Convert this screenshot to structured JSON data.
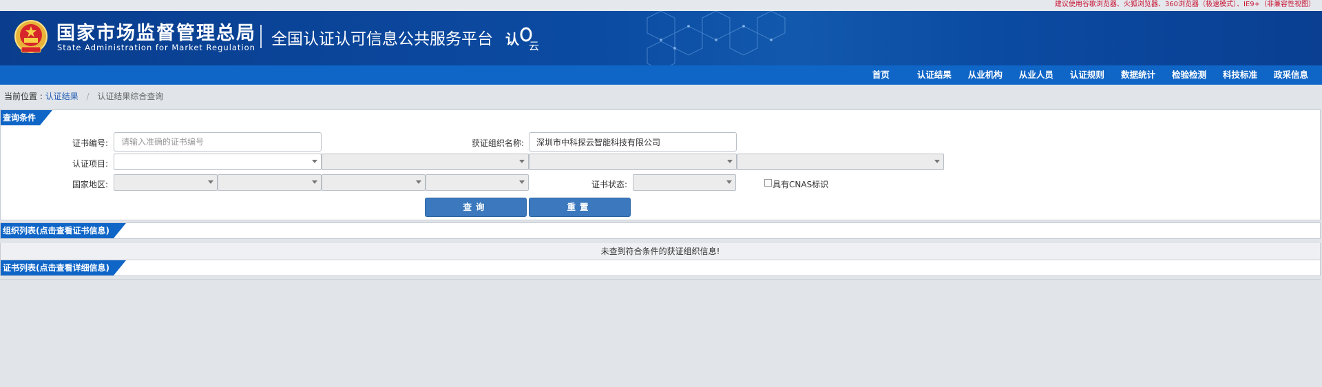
{
  "browser_note": "建议使用谷歌浏览器、火狐浏览器、360浏览器（极速模式）、IE9+（非兼容性视图）",
  "header": {
    "org_name_cn": "国家市场监督管理总局",
    "org_name_en": "State Administration  for  Market Regulation",
    "platform_title": "全国认证认可信息公共服务平台",
    "logo_text_1": "认",
    "logo_text_2": "云"
  },
  "nav": {
    "items": [
      "首页",
      "认证结果",
      "从业机构",
      "从业人员",
      "认证规则",
      "数据统计",
      "检验检测",
      "科技标准",
      "政采信息"
    ]
  },
  "breadcrumb": {
    "prefix": "当前位置 :",
    "link": "认证结果",
    "separator": "/",
    "current": "认证结果综合查询"
  },
  "query": {
    "section_title": "查询条件",
    "cert_no_label": "证书编号:",
    "cert_no_placeholder": "请输入准确的证书编号",
    "cert_no_value": "",
    "org_name_label": "获证组织名称:",
    "org_name_value": "深圳市中科探云智能科技有限公司",
    "project_label": "认证项目:",
    "region_label": "国家地区:",
    "status_label": "证书状态:",
    "cnas_label": "具有CNAS标识",
    "cnas_checked": false,
    "search_button": "查询",
    "reset_button": "重置"
  },
  "org_list": {
    "section_title": "组织列表(点击查看证书信息)",
    "empty_message": "未查到符合条件的获证组织信息!"
  },
  "cert_list": {
    "section_title": "证书列表(点击查看详细信息)"
  },
  "colors": {
    "header_blue": "#0b4ba2",
    "nav_blue": "#1066c7",
    "button_blue": "#3b78bd",
    "notice_red": "#c8102e",
    "page_bg": "#e1e5ea"
  }
}
